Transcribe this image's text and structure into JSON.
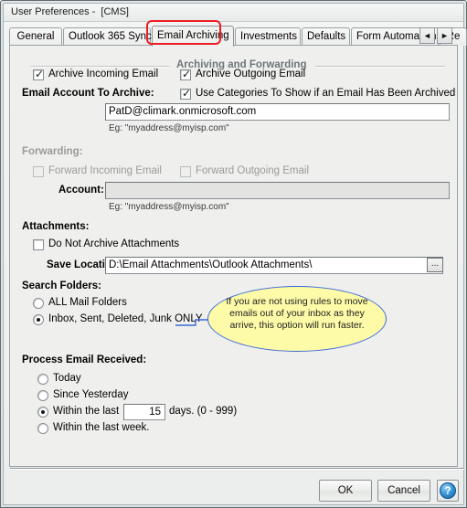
{
  "window": {
    "title": "User Preferences -  [CMS]"
  },
  "tabs": {
    "items": [
      {
        "label": "General",
        "active": false
      },
      {
        "label": "Outlook 365 Sync",
        "active": false
      },
      {
        "label": "Email Archiving",
        "active": true
      },
      {
        "label": "Investments",
        "active": false
      },
      {
        "label": "Defaults",
        "active": false
      },
      {
        "label": "Form Automation",
        "active": false
      },
      {
        "label": "Re",
        "active": false
      }
    ],
    "scroll_left_icon": "◄",
    "scroll_right_icon": "►"
  },
  "archiving_group": {
    "title": "Archiving and Forwarding",
    "archive_incoming": {
      "label": "Archive Incoming Email",
      "checked": true
    },
    "archive_outgoing": {
      "label": "Archive Outgoing Email",
      "checked": true
    },
    "use_categories": {
      "label": "Use Categories To Show if an Email Has Been Archived",
      "checked": true
    },
    "email_account_label": "Email Account To Archive:",
    "email_account_value": "PatD@climark.onmicrosoft.com",
    "email_account_hint": "Eg: \"myaddress@myisp.com\""
  },
  "forwarding": {
    "title": "Forwarding:",
    "forward_incoming": {
      "label": "Forward Incoming Email",
      "checked": false,
      "disabled": true
    },
    "forward_outgoing": {
      "label": "Forward Outgoing Email",
      "checked": false,
      "disabled": true
    },
    "account_label": "Account:",
    "account_value": "",
    "account_hint": "Eg: \"myaddress@myisp.com\""
  },
  "attachments": {
    "title": "Attachments:",
    "do_not_archive": {
      "label": "Do Not Archive Attachments",
      "checked": false
    },
    "save_location_label": "Save Location:",
    "save_location_value": "D:\\Email Attachments\\Outlook Attachments\\",
    "browse_label": "..."
  },
  "search_folders": {
    "title": "Search Folders:",
    "options": [
      {
        "label": "ALL Mail Folders",
        "selected": false
      },
      {
        "label": "Inbox, Sent, Deleted, Junk ONLY",
        "selected": true
      }
    ]
  },
  "process_email": {
    "title": "Process Email Received:",
    "options": [
      {
        "label": "Today",
        "selected": false
      },
      {
        "label": "Since Yesterday",
        "selected": false
      },
      {
        "label": "Within the last",
        "selected": true
      },
      {
        "label": "Within the last week.",
        "selected": false
      }
    ],
    "days_value": "15",
    "days_suffix": "days. (0 - 999)"
  },
  "callout": {
    "text": "If you are not using rules to move emails out of your inbox as they arrive, this option will run faster.",
    "fill_color": "#fdfba8",
    "border_color": "#3b68d4"
  },
  "annotation": {
    "highlight_color": "#ee1c25"
  },
  "footer": {
    "ok_label": "OK",
    "cancel_label": "Cancel",
    "help_label": "?"
  }
}
